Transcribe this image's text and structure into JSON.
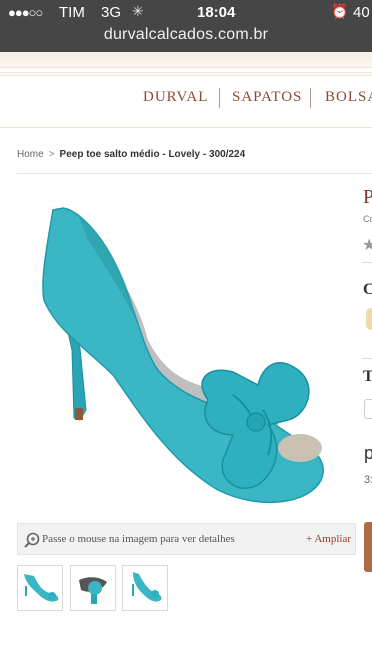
{
  "status_bar": {
    "signal": "●●●○○",
    "carrier": "TIM",
    "network": "3G",
    "time": "18:04",
    "battery": "40"
  },
  "url": "durvalcalcados.com.br",
  "nav": {
    "items": [
      "DURVAL",
      "SAPATOS",
      "BOLSA"
    ]
  },
  "breadcrumb": {
    "home": "Home",
    "separator": ">",
    "current": "Peep toe salto médio - Lovely - 300/224"
  },
  "zoom_hint": {
    "text": "Passe o mouse na imagem para ver detalhes",
    "link": "+ Ampliar"
  },
  "right_column": {
    "title": "P",
    "subtitle": "Cc",
    "heading_color": "C",
    "heading_size": "T",
    "price": "p",
    "installments": "3:"
  },
  "colors": {
    "shoe": "#3bb6c4",
    "accent": "#8e4a2f",
    "link": "#9b3a2a"
  }
}
